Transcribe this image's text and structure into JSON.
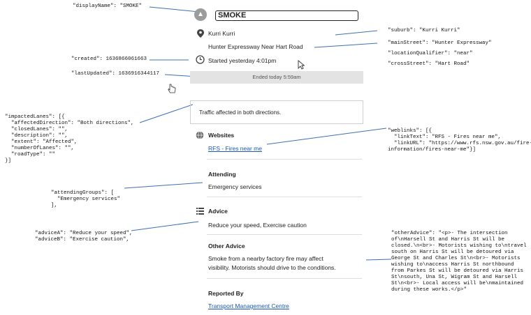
{
  "annotations": {
    "displayName": "\"displayName\": \"SMOKE\"",
    "created": "\"created\": 1636866061663",
    "lastUpdated": "\"lastUpdated\": 1636916344117",
    "impactedLanes": [
      "\"impactedLanes\": [{",
      "  \"affectedDirection\": \"Both directions\",",
      "  \"closedLanes\": \"\",",
      "  \"description\": \"\",",
      "  \"extent\": \"Affected\",",
      "  \"numberOfLanes\": \"\",",
      "  \"roadType\": \"\"",
      "}]"
    ],
    "attendingGroups": [
      "\"attendingGroups\": [",
      "  \"Emergency services\"",
      "],"
    ],
    "advice": [
      "\"adviceA\": \"Reduce your speed\",",
      "\"adviceB\": \"Exercise caution\","
    ],
    "suburb": "\"suburb\": \"Kurri Kurri\"",
    "mainStreet": "\"mainStreet\": \"Hunter Expressway\"",
    "locationQualifier": "\"locationQualifier\": \"near\"",
    "crossStreet": "\"crossStreet\": \"Hart Road\"",
    "weblinks": [
      "\"weblinks\": [{",
      "  \"linkText\": \"RFS - Fires near me\",",
      "  \"linkURL\": \"https://www.rfs.nsw.gov.au/fire-",
      "information/fires-near-me\"}]"
    ],
    "otherAdvice": [
      "\"otherAdvice\": \"<p>- The intersection",
      "of\\nHarsell St and Harris St will be",
      "closed.\\n<br>- Motorists wishing to\\ntravel",
      "south on Harris St will be detoured via",
      "George St and Charles St\\n<br>- Motorists",
      "wishing to\\naccess Harris St northbound",
      "from Parkes St will be detoured via Harris",
      "St\\nsouth, Una St, Wigram St and Harsell",
      "St\\n<br>- Local access will be\\nmaintained",
      "during these works.</p>\""
    ]
  },
  "panel": {
    "title": "SMOKE",
    "suburb": "Kurri Kurri",
    "street": "Hunter Expressway Near Hart Road",
    "started": "Started yesterday 4:01pm",
    "ended": "Ended today 5:59am",
    "traffic": "Traffic affected in both directions.",
    "websites_header": "Websites",
    "websites_link": "RFS - Fires near me",
    "attending_header": "Attending",
    "attending_value": "Emergency services",
    "advice_header": "Advice",
    "advice_value": "Reduce your speed, Exercise caution",
    "other_header": "Other Advice",
    "other_line1": "Smoke from a nearby factory fire may affect",
    "other_line2": "visibility. Motorists should drive to the conditions.",
    "reported_header": "Reported By",
    "reported_link": "Transport Management Centre"
  },
  "colors": {
    "connector": "#3d6fb4",
    "link": "#1a56b5",
    "ended_bar": "#e3e3e3"
  },
  "icons": [
    "warning-icon",
    "location-pin-icon",
    "clock-icon",
    "globe-icon",
    "list-icon",
    "cursor-icon",
    "hand-pointer-icon"
  ]
}
